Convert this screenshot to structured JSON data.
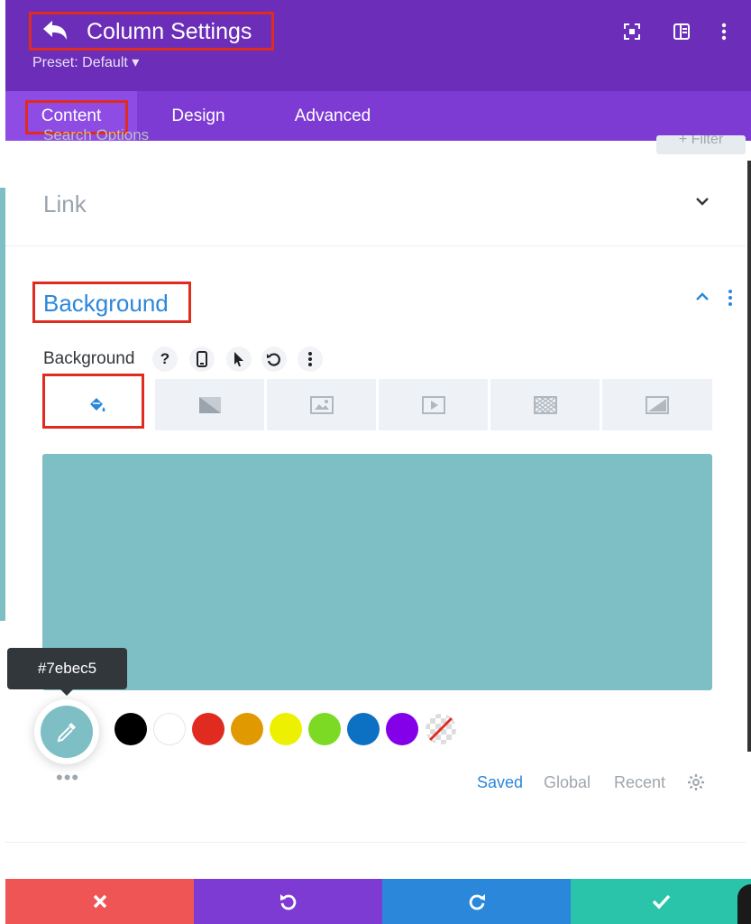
{
  "header": {
    "title": "Column Settings",
    "preset": "Preset: Default ▾"
  },
  "tabs": [
    {
      "label": "Content",
      "active": true
    },
    {
      "label": "Design",
      "active": false
    },
    {
      "label": "Advanced",
      "active": false
    }
  ],
  "faded": {
    "search": "Search Options",
    "filter": "+ Filter"
  },
  "sections": {
    "link": {
      "title": "Link",
      "expanded": false
    },
    "background": {
      "title": "Background",
      "expanded": true
    }
  },
  "background_field": {
    "label": "Background",
    "help_icon": "?",
    "type_tabs": [
      {
        "icon": "paint-bucket-icon",
        "active": true
      },
      {
        "icon": "gradient-icon",
        "active": false
      },
      {
        "icon": "image-icon",
        "active": false
      },
      {
        "icon": "video-icon",
        "active": false
      },
      {
        "icon": "pattern-icon",
        "active": false
      },
      {
        "icon": "mask-icon",
        "active": false
      }
    ],
    "color_value": "#7ebec5",
    "tooltip": "#7ebec5",
    "swatches": [
      "#000000",
      "#ffffff",
      "#e02b20",
      "#e09900",
      "#edf000",
      "#7cda24",
      "#0c71c3",
      "#8300e9"
    ],
    "palette_tabs": [
      {
        "label": "Saved",
        "active": true
      },
      {
        "label": "Global",
        "active": false
      },
      {
        "label": "Recent",
        "active": false
      }
    ],
    "more": "•••"
  },
  "footer": {
    "cancel": "cancel",
    "undo": "undo",
    "redo": "redo",
    "save": "save"
  },
  "colors": {
    "header_purple": "#6c2eb9",
    "tab_purple": "#7d3bd4",
    "accent_blue": "#2b87da",
    "footer_red": "#ef5555",
    "footer_purple": "#7d3bd4",
    "footer_blue": "#2b87da",
    "footer_green": "#29c4a9"
  }
}
